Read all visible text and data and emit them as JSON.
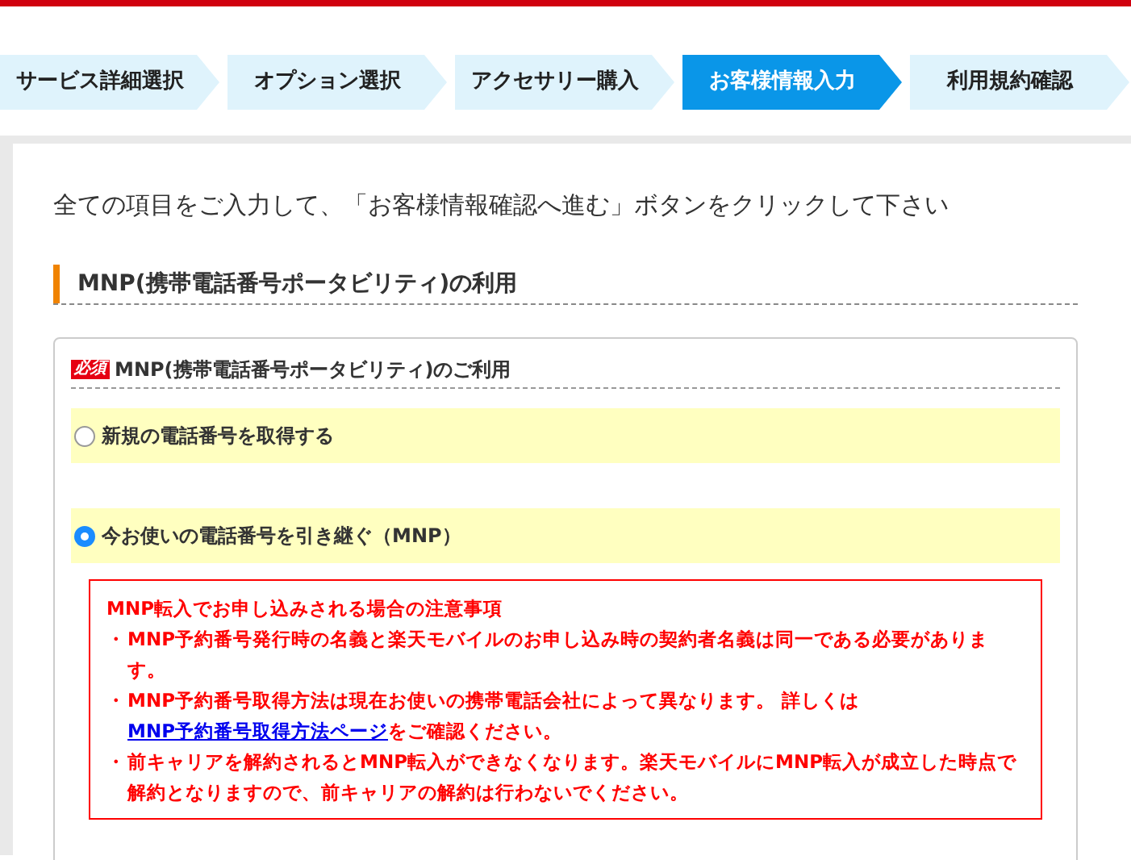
{
  "steps": [
    {
      "label": "サービス詳細選択",
      "selected": false
    },
    {
      "label": "オプション選択",
      "selected": false
    },
    {
      "label": "アクセサリー購入",
      "selected": false
    },
    {
      "label": "お客様情報入力",
      "selected": true
    },
    {
      "label": "利用規約確認",
      "selected": false
    }
  ],
  "intro": "全ての項目をご入力して、「お客様情報確認へ進む」ボタンをクリックして下さい",
  "section_heading": "MNP(携帯電話番号ポータビリティ)の利用",
  "field": {
    "required_badge": "必須",
    "label": "MNP(携帯電話番号ポータビリティ)のご利用",
    "options": [
      {
        "label": "新規の電話番号を取得する",
        "selected": false
      },
      {
        "label": "今お使いの電話番号を引き継ぐ（MNP）",
        "selected": true
      }
    ]
  },
  "notice": {
    "title": "MNP転入でお申し込みされる場合の注意事項",
    "items": [
      {
        "bullet": "・",
        "parts": [
          {
            "kind": "text",
            "text": "MNP予約番号発行時の名義と楽天モバイルのお申し込み時の契約者名義は同一である必要があります。"
          }
        ]
      },
      {
        "bullet": "・",
        "parts": [
          {
            "kind": "text",
            "text": "MNP予約番号取得方法は現在お使いの携帯電話会社によって異なります。 詳しくは"
          },
          {
            "kind": "link",
            "text": "MNP予約番号取得方法ページ"
          },
          {
            "kind": "text",
            "text": "をご確認ください。"
          }
        ]
      },
      {
        "bullet": "・",
        "parts": [
          {
            "kind": "text",
            "text": "前キャリアを解約されるとMNP転入ができなくなります。楽天モバイルにMNP転入が成立した時点で解約となりますので、前キャリアの解約は行わないでください。"
          }
        ]
      }
    ]
  }
}
